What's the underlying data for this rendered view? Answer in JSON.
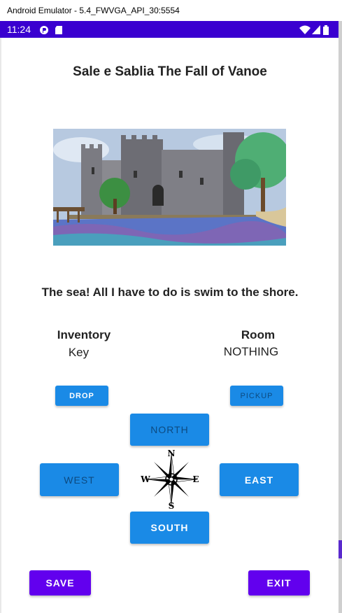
{
  "window": {
    "title": "Android Emulator - 5.4_FWVGA_API_30:5554"
  },
  "status_bar": {
    "time": "11:24"
  },
  "game": {
    "title": "Sale e Sablia The Fall of Vanoe",
    "message": "The sea! All I have to do is swim to the shore.",
    "inventory": {
      "label": "Inventory",
      "value": "Key"
    },
    "room": {
      "label": "Room",
      "value": "NOTHING"
    }
  },
  "buttons": {
    "drop": "DROP",
    "pickup": "PICKUP",
    "north": "NORTH",
    "west": "WEST",
    "east": "EAST",
    "south": "SOUTH",
    "save": "SAVE",
    "exit": "EXIT"
  },
  "compass": {
    "n": "N",
    "s": "S",
    "e": "E",
    "w": "W"
  },
  "colors": {
    "status_bar": "#3a00d0",
    "button_blue": "#1a8ae6",
    "button_purple": "#6200ee"
  }
}
